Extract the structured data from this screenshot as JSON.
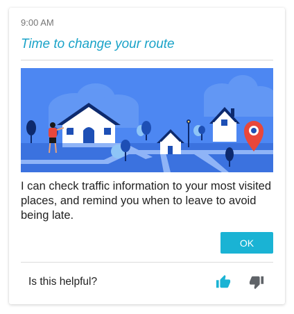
{
  "card": {
    "time": "9:00 AM",
    "title": "Time to change your route",
    "body": "I can check traffic information to your most visited places, and remind you when to leave to avoid being late.",
    "ok_label": "OK",
    "feedback_question": "Is this helpful?"
  },
  "colors": {
    "accent": "#1ab3d4",
    "title": "#1aa3c8",
    "thumb_up": "#1ab3d4",
    "thumb_down": "#5f6368",
    "illustration_sky": "#4d87f2",
    "map_pin": "#e8473b"
  },
  "icons": {
    "thumb_up": "thumb-up-icon",
    "thumb_down": "thumb-down-icon",
    "map_pin": "map-pin-icon"
  }
}
